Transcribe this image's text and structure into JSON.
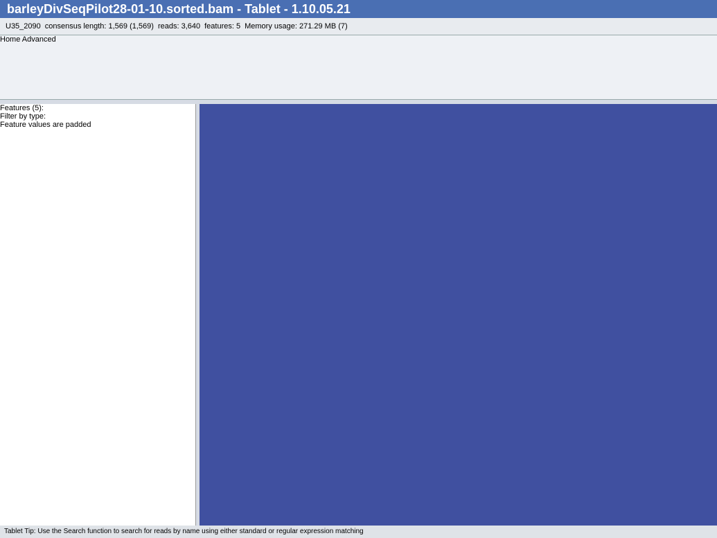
{
  "window": {
    "title": "barleyDivSeqPilot28-01-10.sorted.bam - Tablet - 1.10.05.21"
  },
  "info": {
    "contig": "U35_2090",
    "consensus": "consensus length: 1,569 (1,569)",
    "reads": "reads: 3,640",
    "features": "features: 5",
    "memory": "Memory usage: 271.29 MB (7)"
  },
  "tabs": [
    "Home",
    "Advanced"
  ],
  "left": {
    "features_label": "Features (5):",
    "filter_label": "Filter by type:",
    "padded": "Feature values are padded"
  },
  "status": {
    "tip": "Tablet Tip:  Use the Search function to search for reads by name using either standard or regular expression matching"
  }
}
